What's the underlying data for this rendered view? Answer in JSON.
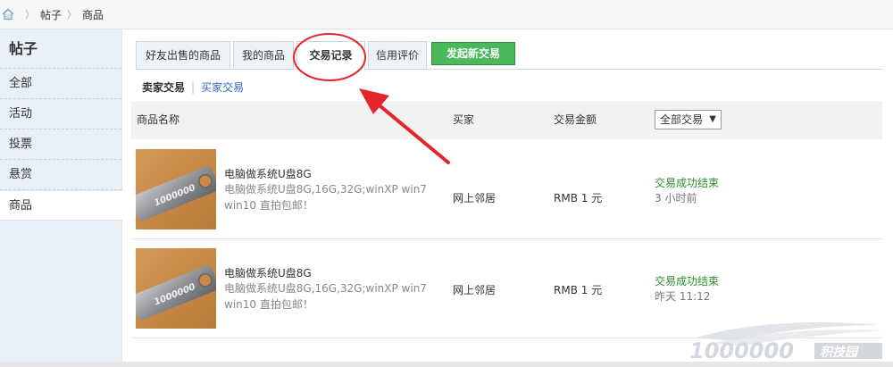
{
  "breadcrumb": {
    "items": [
      "帖子",
      "商品"
    ]
  },
  "sidebar": {
    "title": "帖子",
    "items": [
      {
        "label": "全部"
      },
      {
        "label": "活动"
      },
      {
        "label": "投票"
      },
      {
        "label": "悬赏"
      },
      {
        "label": "商品"
      }
    ],
    "active": "商品"
  },
  "tabs": [
    {
      "label": "好友出售的商品"
    },
    {
      "label": "我的商品"
    },
    {
      "label": "交易记录"
    },
    {
      "label": "信用评价"
    }
  ],
  "active_tab": "交易记录",
  "new_trade_button": "发起新交易",
  "subtabs": {
    "seller": "卖家交易",
    "buyer": "买家交易"
  },
  "table": {
    "headers": {
      "product": "商品名称",
      "buyer": "买家",
      "amount": "交易金额"
    },
    "filter": {
      "selected": "全部交易"
    },
    "rows": [
      {
        "name": "电脑做系统U盘8G",
        "desc": "电脑做系统U盘8G,16G,32G;winXP win7 win10 直拍包邮！",
        "buyer": "网上邻居",
        "amount": "RMB 1 元",
        "status": "交易成功结束",
        "time": "3 小时前"
      },
      {
        "name": "电脑做系统U盘8G",
        "desc": "电脑做系统U盘8G,16G,32G;winXP win7 win10 直拍包邮！",
        "buyer": "网上邻居",
        "amount": "RMB 1 元",
        "status": "交易成功结束",
        "time": "昨天 11:12"
      }
    ]
  },
  "thumbnail_text": "1000000",
  "watermark": {
    "number": "1000000",
    "suffix": "积技园"
  },
  "colors": {
    "accent_green": "#4cb85c",
    "link_blue": "#3366cc",
    "status_green": "#2e8b2e",
    "annotation_red": "#e3262b"
  },
  "icons": {
    "home": "home-icon",
    "dropdown": "chevron-down-icon"
  }
}
